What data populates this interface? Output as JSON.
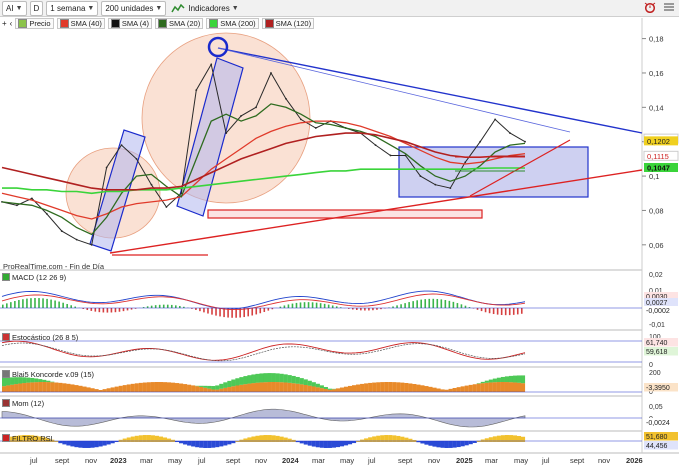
{
  "toolbar": {
    "symbol": "AI",
    "d_button": "D",
    "period": "1 semana",
    "units": "200 unidades",
    "indicators_button": "Indicadores"
  },
  "legend": {
    "price": "Precio",
    "sma40": "SMA (40)",
    "sma4": "SMA (4)",
    "sma20": "SMA (20)",
    "sma200": "SMA (200)",
    "sma120": "SMA (120)"
  },
  "colors": {
    "sma40": "#e03a2a",
    "sma4": "#111111",
    "sma20": "#2e6b1f",
    "sma200": "#3ad43a",
    "sma120": "#b02020",
    "trend_blue": "#2233cc",
    "trend_red": "#dd2222",
    "box_fill": "#c5c8ee"
  },
  "source_note": "ProRealTime.com - Fin de Día",
  "price_axis": {
    "ticks": [
      "0,18",
      "0,16",
      "0,14",
      "0,12",
      "0,1",
      "0,08",
      "0,06"
    ],
    "badges": [
      {
        "label": "0,1212",
        "color": "#ffffff",
        "text": "#222222"
      },
      {
        "label": "0,1202",
        "color": "#f0d020",
        "text": "#222222"
      },
      {
        "label": "0,1115",
        "color": "#ffffff",
        "text": "#cc2222"
      },
      {
        "label": "0,1047",
        "color": "#3ad43a",
        "text": "#111111"
      }
    ]
  },
  "panels": {
    "macd": {
      "title": "MACD (12 26 9)",
      "ticks": [
        "0,02",
        "0,01",
        "0",
        "-0,01"
      ],
      "badges": [
        "0,0030",
        "0,0027",
        "-0,0002"
      ]
    },
    "stoch": {
      "title": "Estocástico (26 8 5)",
      "ticks": [
        "100",
        "0"
      ],
      "badges": [
        "61,740",
        "59,618"
      ]
    },
    "koncorde": {
      "title": "Blai5 Koncorde v.09 (15)",
      "ticks": [
        "200",
        "0"
      ],
      "badges": [
        "-3,3950"
      ]
    },
    "mom": {
      "title": "Mom (12)",
      "ticks": [
        "0,05",
        "0"
      ],
      "badges": [
        "-0,0024"
      ]
    },
    "rsi": {
      "title": "FILTRO RSI",
      "ticks": [
        "50"
      ],
      "badges": [
        "51,680",
        "44,456"
      ]
    }
  },
  "x_axis": {
    "labels": [
      {
        "text": "jul",
        "bold": false
      },
      {
        "text": "sept",
        "bold": false
      },
      {
        "text": "nov",
        "bold": false
      },
      {
        "text": "2023",
        "bold": true
      },
      {
        "text": "mar",
        "bold": false
      },
      {
        "text": "may",
        "bold": false
      },
      {
        "text": "jul",
        "bold": false
      },
      {
        "text": "sept",
        "bold": false
      },
      {
        "text": "nov",
        "bold": false
      },
      {
        "text": "2024",
        "bold": true
      },
      {
        "text": "mar",
        "bold": false
      },
      {
        "text": "may",
        "bold": false
      },
      {
        "text": "jul",
        "bold": false
      },
      {
        "text": "sept",
        "bold": false
      },
      {
        "text": "nov",
        "bold": false
      },
      {
        "text": "2025",
        "bold": true
      },
      {
        "text": "mar",
        "bold": false
      },
      {
        "text": "may",
        "bold": false
      },
      {
        "text": "jul",
        "bold": false
      },
      {
        "text": "sept",
        "bold": false
      },
      {
        "text": "nov",
        "bold": false
      },
      {
        "text": "2026",
        "bold": true
      }
    ]
  },
  "chart_data": {
    "type": "line",
    "title": "",
    "xlabel": "",
    "ylabel": "",
    "ylim": [
      0.05,
      0.185
    ],
    "x": [
      "2022-06",
      "2022-07",
      "2022-08",
      "2022-09",
      "2022-10",
      "2022-11",
      "2022-12",
      "2023-01",
      "2023-02",
      "2023-03",
      "2023-04",
      "2023-05",
      "2023-06",
      "2023-07",
      "2023-08",
      "2023-09",
      "2023-10",
      "2023-11",
      "2023-12",
      "2024-01",
      "2024-02",
      "2024-03",
      "2024-04",
      "2024-05",
      "2024-06",
      "2024-07",
      "2024-08",
      "2024-09",
      "2024-10",
      "2024-11",
      "2024-12",
      "2025-01",
      "2025-02",
      "2025-03",
      "2025-04",
      "2025-05"
    ],
    "series": [
      {
        "name": "Precio",
        "values": [
          0.085,
          0.083,
          0.087,
          0.078,
          0.068,
          0.063,
          0.06,
          0.105,
          0.118,
          0.11,
          0.095,
          0.082,
          0.09,
          0.15,
          0.165,
          0.125,
          0.135,
          0.14,
          0.16,
          0.145,
          0.133,
          0.128,
          0.132,
          0.128,
          0.125,
          0.118,
          0.112,
          0.112,
          0.1,
          0.095,
          0.093,
          0.108,
          0.12,
          0.133,
          0.125,
          0.12
        ]
      },
      {
        "name": "SMA (40)",
        "values": [
          0.09,
          0.088,
          0.086,
          0.083,
          0.08,
          0.077,
          0.075,
          0.078,
          0.082,
          0.084,
          0.085,
          0.086,
          0.088,
          0.096,
          0.104,
          0.11,
          0.116,
          0.122,
          0.126,
          0.129,
          0.131,
          0.132,
          0.132,
          0.131,
          0.129,
          0.126,
          0.123,
          0.119,
          0.115,
          0.111,
          0.108,
          0.107,
          0.108,
          0.11,
          0.112,
          0.113
        ]
      },
      {
        "name": "SMA (20)",
        "values": [
          0.085,
          0.084,
          0.083,
          0.08,
          0.076,
          0.07,
          0.066,
          0.076,
          0.09,
          0.1,
          0.101,
          0.094,
          0.088,
          0.11,
          0.132,
          0.136,
          0.132,
          0.135,
          0.142,
          0.14,
          0.136,
          0.131,
          0.13,
          0.128,
          0.126,
          0.123,
          0.118,
          0.113,
          0.106,
          0.1,
          0.097,
          0.1,
          0.106,
          0.114,
          0.118,
          0.119
        ]
      },
      {
        "name": "SMA (200)",
        "values": [
          0.093,
          0.093,
          0.092,
          0.092,
          0.091,
          0.091,
          0.09,
          0.091,
          0.091,
          0.092,
          0.092,
          0.092,
          0.093,
          0.094,
          0.095,
          0.096,
          0.097,
          0.098,
          0.099,
          0.1,
          0.101,
          0.102,
          0.103,
          0.103,
          0.104,
          0.104,
          0.104,
          0.104,
          0.104,
          0.104,
          0.104,
          0.104,
          0.1045,
          0.1047,
          0.1047,
          0.1047
        ]
      },
      {
        "name": "SMA (120)",
        "values": [
          0.105,
          0.103,
          0.101,
          0.099,
          0.097,
          0.095,
          0.093,
          0.092,
          0.092,
          0.092,
          0.093,
          0.093,
          0.094,
          0.098,
          0.102,
          0.106,
          0.11,
          0.113,
          0.116,
          0.119,
          0.121,
          0.123,
          0.124,
          0.125,
          0.125,
          0.124,
          0.122,
          0.12,
          0.117,
          0.114,
          0.112,
          0.111,
          0.111,
          0.1115,
          0.1115,
          0.1115
        ]
      }
    ]
  }
}
